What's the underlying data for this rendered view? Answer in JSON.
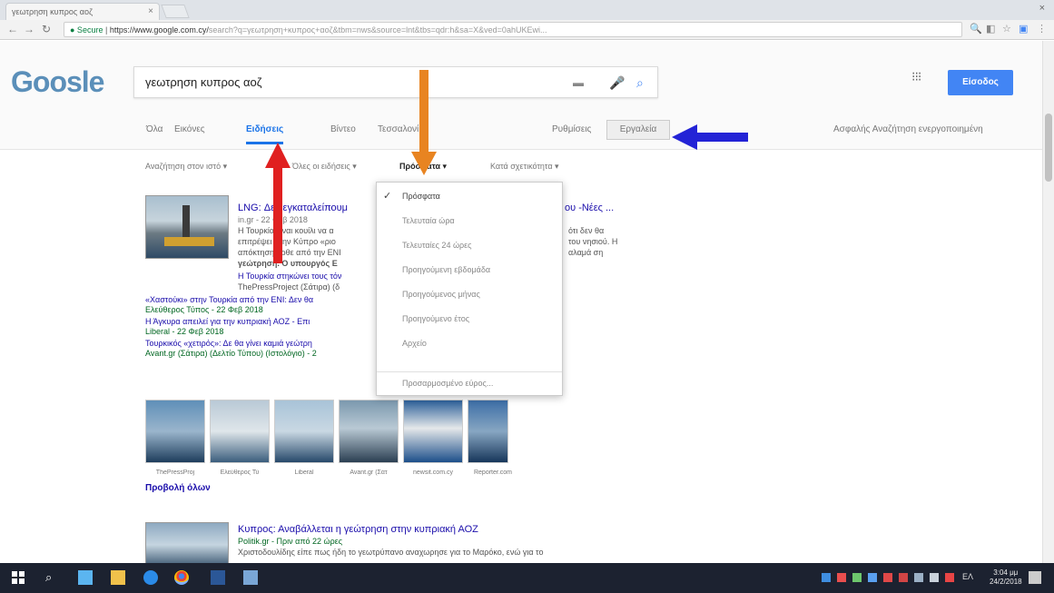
{
  "browser": {
    "tab_title": "γεωτρηση κυπρος αοζ",
    "tab_close": "×",
    "window_close": "×",
    "url_secure": "● Secure",
    "url_main": "https://www.google.com.cy/",
    "url_rest": "search?q=γεωτρηση+κυπρος+αοζ&tbm=nws&source=lnt&tbs=qdr:h&sa=X&ved=0ahUKEwi..."
  },
  "header": {
    "logo": "Goosle",
    "search_value": "γεωτρηση κυπρος αοζ",
    "signin_label": "Είσοδος"
  },
  "tabs": [
    {
      "label": "Όλα"
    },
    {
      "label": "Εικόνες"
    },
    {
      "label": "Ειδήσεις"
    },
    {
      "label": "Βίντεο"
    },
    {
      "label": "Τεσσαλονίκη"
    },
    {
      "label": "Ρυθμίσεις"
    }
  ],
  "tools_label": "Εργαλεία",
  "safesearch_label": "Ασφαλής Αναζήτηση ενεργοποιημένη",
  "filters": {
    "search_all": "Αναζήτηση στον ιστό ▾",
    "all_news": "Όλες οι ειδήσεις ▾",
    "time": "Πρόσφατα ▾",
    "sort": "Κατά σχετικότητα ▾"
  },
  "time_menu": {
    "check": "✓",
    "items": [
      "Πρόσφατα",
      "Τελευταία ώρα",
      "Τελευταίες 24 ώρες",
      "Προηγούμενη εβδομάδα",
      "Προηγούμενος μήνας",
      "Προηγούμενο έτος",
      "Αρχείο",
      "Προσαρμοσμένο εύρος..."
    ]
  },
  "results": [
    {
      "title_a": "LNG: Δεν εγκαταλείπουμ",
      "title_b": "ου -Νέες ...",
      "source": "in.gr - 22 Φεβ 2018",
      "lines": [
        "Η Τουρκία είναι κουίλι να α",
        "επιτρέψει στην Κύπρο «ριο",
        "απόκτηση ήρθε από την ΕΝΙ",
        "γεώτρηση. Ο υπουργός Ε"
      ],
      "lines_right": [
        "ότι δεν θα",
        "του νησιού. Η",
        "αλαμά ση"
      ],
      "sub1": "Η Τουρκία στηκώνει τους τόν",
      "sub1_src": "ThePressProject (Σάτιρα) (δ",
      "links": [
        {
          "text": "«Χαστούκι» στην Τουρκία από την ΕΝΙ: Δεν θα",
          "src": "Ελεύθερος Τύπος - 22 Φεβ 2018"
        },
        {
          "text": "Η Άγκυρα απειλεί για την κυπριακή ΑΟΖ - Επι",
          "src": "Liberal - 22 Φεβ 2018"
        },
        {
          "text": "Τουρκικός «χετιρός»: Δε θα γίνει καμιά γεώτρη",
          "src": "Avant.gr (Σάτιρα) (Δελτίο Τύπου) (Ιστολόγιο) - 2"
        }
      ]
    }
  ],
  "image_strip": {
    "captions": [
      "ThePressProj",
      "Ελεύθερος Τύ",
      "Liberal",
      "Avant.gr (Σάτ",
      "newsit.com.cy",
      "Reporter.com"
    ]
  },
  "view_all": "Προβολή όλων",
  "result2": {
    "title": "Κυπρος: Αναβάλλεται η γεώτρηση στην κυπριακή ΑΟΖ",
    "source": "Politik.gr - Πριν από 22 ώρες",
    "snippet": "Χριστοδουλίδης είπε πως ήδη το γεωτρύπανο αναχωρησε για το Μαρόκο, ενώ για το"
  },
  "taskbar": {
    "lang": "ΕΛ",
    "time": "3:04 μμ",
    "date": "24/2/2018"
  },
  "colors": {
    "accent_blue": "#4285f4",
    "arrow_red": "#e02020",
    "arrow_orange": "#e88421",
    "arrow_blue": "#2323d6"
  }
}
